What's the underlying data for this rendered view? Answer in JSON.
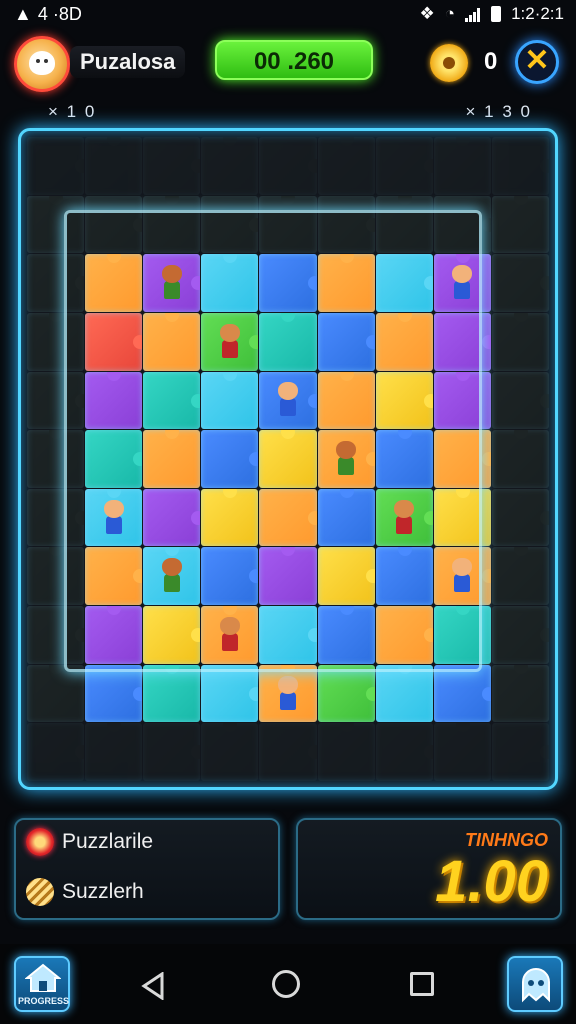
{
  "status_bar": {
    "time_left": "4 ·8D",
    "time_right": "1:2·2:1"
  },
  "hud": {
    "player_name": "Puzalosa",
    "score": "00 .260",
    "coin_count": "0",
    "multiplier_left": "× 1 0",
    "multiplier_right": "× 1 3 0"
  },
  "panels": {
    "item1_label": "Puzzlarile",
    "item2_label": "Suzzlerh",
    "timer_label": "TINHNGO",
    "timer_value": "1.00"
  },
  "home_button_label": "PROGRESS",
  "colors": {
    "accent_cyan": "#52d6ff",
    "score_green": "#4ee023",
    "timer_gold": "#ffd21f",
    "timer_label_orange": "#ff7a18"
  },
  "board": {
    "cols": 9,
    "rows": 11,
    "tiles": [
      "d",
      "d",
      "d",
      "d",
      "d",
      "d",
      "d",
      "d",
      "d",
      "d",
      "d",
      "d",
      "d",
      "d",
      "d",
      "d",
      "d",
      "d",
      "d",
      "o",
      "p",
      "c",
      "b",
      "o",
      "c",
      "p",
      "d",
      "d",
      "r",
      "o",
      "g",
      "t",
      "b",
      "o",
      "p",
      "d",
      "d",
      "p",
      "t",
      "c",
      "b",
      "o",
      "y",
      "p",
      "d",
      "d",
      "t",
      "o",
      "b",
      "y",
      "o",
      "b",
      "o",
      "d",
      "d",
      "c",
      "p",
      "y",
      "o",
      "b",
      "g",
      "y",
      "d",
      "d",
      "o",
      "c",
      "b",
      "p",
      "y",
      "b",
      "o",
      "d",
      "d",
      "p",
      "y",
      "o",
      "c",
      "b",
      "o",
      "t",
      "d",
      "d",
      "b",
      "t",
      "c",
      "o",
      "g",
      "c",
      "b",
      "d",
      "d",
      "d",
      "d",
      "d",
      "d",
      "d",
      "d",
      "d",
      "d"
    ]
  }
}
